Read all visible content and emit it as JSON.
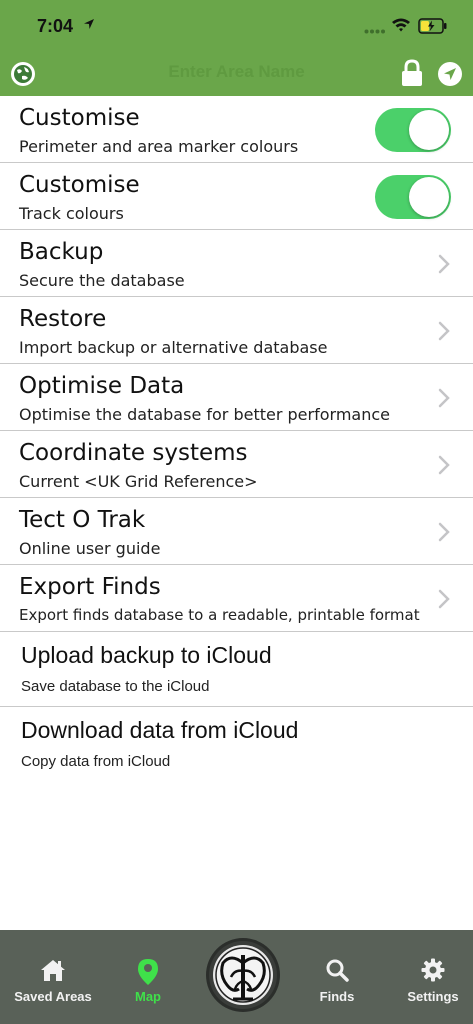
{
  "status": {
    "time": "7:04"
  },
  "header": {
    "area_name_placeholder": "Enter Area Name"
  },
  "rows": [
    {
      "title": "Customise",
      "subtitle": "Perimeter and area marker colours",
      "control": "toggle",
      "on": true
    },
    {
      "title": "Customise",
      "subtitle": "Track colours",
      "control": "toggle",
      "on": true
    },
    {
      "title": "Backup",
      "subtitle": "Secure the database",
      "control": "chevron"
    },
    {
      "title": "Restore",
      "subtitle": "Import backup or alternative database",
      "control": "chevron"
    },
    {
      "title": "Optimise Data",
      "subtitle": "Optimise the database for better performance",
      "control": "chevron"
    },
    {
      "title": "Coordinate systems",
      "subtitle": "Current <UK Grid Reference>",
      "control": "chevron"
    },
    {
      "title": "Tect O Trak",
      "subtitle": "Online user guide",
      "control": "chevron"
    },
    {
      "title": "Export Finds",
      "subtitle": "Export finds database to a readable, printable format",
      "control": "chevron"
    },
    {
      "title": "Upload backup to iCloud",
      "subtitle": "Save database to the iCloud",
      "control": "none"
    },
    {
      "title": "Download data from iCloud",
      "subtitle": "Copy data from iCloud",
      "control": "none"
    }
  ],
  "tabbar": {
    "saved_areas": "Saved Areas",
    "map": "Map",
    "finds": "Finds",
    "settings": "Settings"
  },
  "colors": {
    "header": "#6aa64a",
    "toggle_on": "#4bd06a",
    "tabbar": "#596158",
    "tab_active": "#3fe04a"
  },
  "icons": [
    "location-arrow-icon",
    "wifi-icon",
    "battery-charging-icon",
    "globe-icon",
    "lock-icon",
    "navigation-icon",
    "chevron-right-icon",
    "home-icon",
    "map-pin-icon",
    "tree-logo-icon",
    "search-icon",
    "gear-icon"
  ]
}
